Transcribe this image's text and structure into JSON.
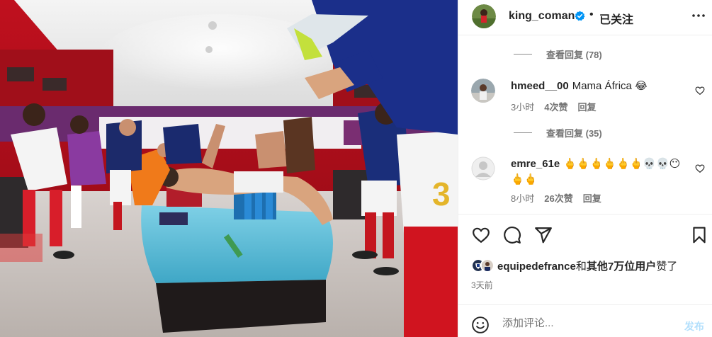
{
  "post": {
    "username": "king_coman",
    "separator": "•",
    "follow_label": "已关注",
    "photo_shirt_number": "3"
  },
  "comments_section": {
    "view_replies_top": "查看回复 (78)",
    "comment1": {
      "username": "hmeed__00",
      "text": "Mama África 😂",
      "time": "3小时",
      "likes": "4次赞",
      "reply": "回复"
    },
    "view_replies_mid": "查看回复 (35)",
    "comment2": {
      "username": "emre_61e",
      "text": "🖕🖕🖕🖕🖕🖕💀💀😶🖕🖕",
      "time": "8小时",
      "likes": "26次赞",
      "reply": "回复"
    }
  },
  "likes": {
    "account": "equipedefrance",
    "connector": "和",
    "others": "其他7万位用户",
    "suffix": "赞了"
  },
  "timestamp": "3天前",
  "composer": {
    "placeholder": "添加评论...",
    "post_label": "发布"
  },
  "icons": [
    "verified-badge-icon",
    "more-options-icon",
    "heart-icon",
    "comment-icon",
    "share-icon",
    "save-icon",
    "emoji-icon"
  ],
  "colors": {
    "verified_blue": "#0095f6",
    "post_disabled": "#b2dffc",
    "muted_text": "#737373"
  }
}
